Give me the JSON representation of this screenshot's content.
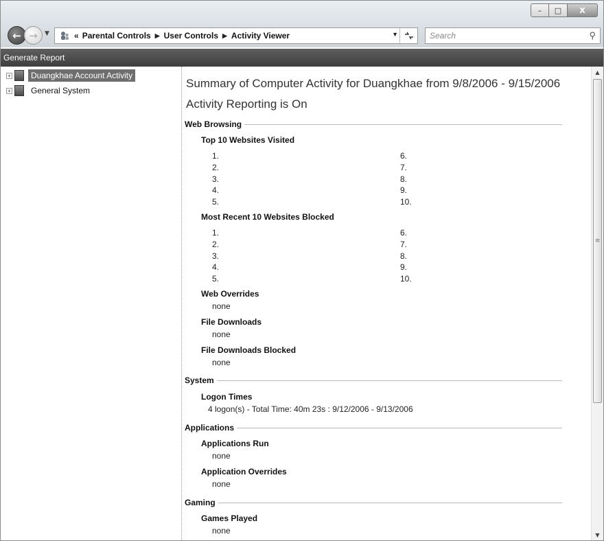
{
  "window": {
    "controls": {
      "minimize": "–",
      "maximize": "□",
      "close": "X"
    }
  },
  "nav": {
    "back_glyph": "←",
    "forward_glyph": "→",
    "overflow": "«",
    "breadcrumbs": [
      "Parental Controls",
      "User Controls",
      "Activity Viewer"
    ],
    "search_placeholder": "Search"
  },
  "command_bar": {
    "generate_report": "Generate Report"
  },
  "tree": {
    "items": [
      {
        "label": "Duangkhae Account Activity",
        "selected": true
      },
      {
        "label": "General System",
        "selected": false
      }
    ]
  },
  "report": {
    "title": "Summary of Computer Activity for Duangkhae from 9/8/2006 - 9/15/2006",
    "status": "Activity Reporting is On",
    "web_browsing": {
      "heading": "Web Browsing",
      "top_visited": {
        "heading": "Top 10 Websites Visited",
        "left": [
          "1.",
          "2.",
          "3.",
          "4.",
          "5."
        ],
        "right": [
          "6.",
          "7.",
          "8.",
          "9.",
          "10."
        ]
      },
      "recent_blocked": {
        "heading": "Most Recent 10 Websites Blocked",
        "left": [
          "1.",
          "2.",
          "3.",
          "4.",
          "5."
        ],
        "right": [
          "6.",
          "7.",
          "8.",
          "9.",
          "10."
        ]
      },
      "web_overrides": {
        "heading": "Web Overrides",
        "value": "none"
      },
      "file_downloads": {
        "heading": "File Downloads",
        "value": "none"
      },
      "file_downloads_blocked": {
        "heading": "File Downloads Blocked",
        "value": "none"
      }
    },
    "system": {
      "heading": "System",
      "logon_times": {
        "heading": "Logon Times",
        "value": "4 logon(s) - Total Time: 40m 23s : 9/12/2006 - 9/13/2006"
      }
    },
    "applications": {
      "heading": "Applications",
      "applications_run": {
        "heading": "Applications Run",
        "value": "none"
      },
      "application_overrides": {
        "heading": "Application Overrides",
        "value": "none"
      }
    },
    "gaming": {
      "heading": "Gaming",
      "games_played": {
        "heading": "Games Played",
        "value": "none"
      }
    }
  },
  "colors": {
    "command_bar": "#4a4a4a",
    "selection": "#6e6e6e",
    "rule": "#b8b8b8"
  }
}
